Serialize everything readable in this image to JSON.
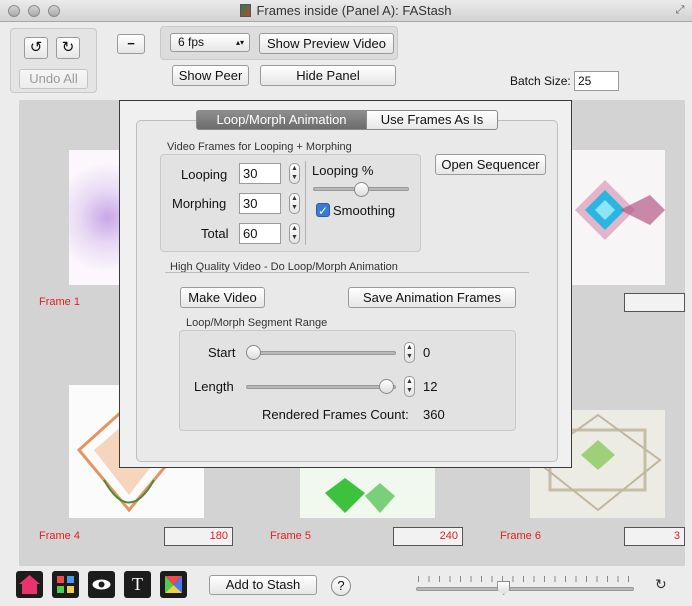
{
  "window": {
    "title": "Frames inside (Panel A): FAStash"
  },
  "toolbar": {
    "undo_all": "Undo All",
    "minus": "−",
    "fps_selected": "6 fps",
    "show_preview": "Show Preview Video",
    "show_peer": "Show Peer",
    "hide_panel": "Hide Panel",
    "batch_size_label": "Batch Size:",
    "batch_size_value": "25"
  },
  "frames": [
    {
      "label": "Frame 1",
      "value": ""
    },
    {
      "label": "Frame 4",
      "value": "180"
    },
    {
      "label": "Frame 5",
      "value": "240"
    },
    {
      "label": "Frame 6",
      "value": "3"
    }
  ],
  "panel": {
    "tabs": [
      "Loop/Morph Animation",
      "Use Frames As Is"
    ],
    "video_frames_group": "Video Frames for Looping + Morphing",
    "looping_label": "Looping",
    "looping_value": "30",
    "morphing_label": "Morphing",
    "morphing_value": "30",
    "total_label": "Total",
    "total_value": "60",
    "looping_pct_label": "Looping %",
    "looping_pct": 0.5,
    "smoothing_label": "Smoothing",
    "smoothing_checked": true,
    "open_sequencer": "Open Sequencer",
    "hq_group": "High Quality Video - Do Loop/Morph Animation",
    "make_video": "Make Video",
    "save_frames": "Save Animation Frames",
    "segment_group": "Loop/Morph Segment Range",
    "start_label": "Start",
    "start_value": "0",
    "length_label": "Length",
    "length_value": "12",
    "rendered_label": "Rendered Frames Count:",
    "rendered_value": "360"
  },
  "bottom": {
    "add_to_stash": "Add to Stash",
    "help": "?",
    "zoom_level": 0.4,
    "icons": [
      "home-icon",
      "grid-icon",
      "eye-icon",
      "text-icon",
      "color-icon"
    ]
  },
  "colors": {
    "frame_label": "#e02020",
    "home_icon": "#e8336f",
    "checkbox": "#3a7bd5"
  }
}
